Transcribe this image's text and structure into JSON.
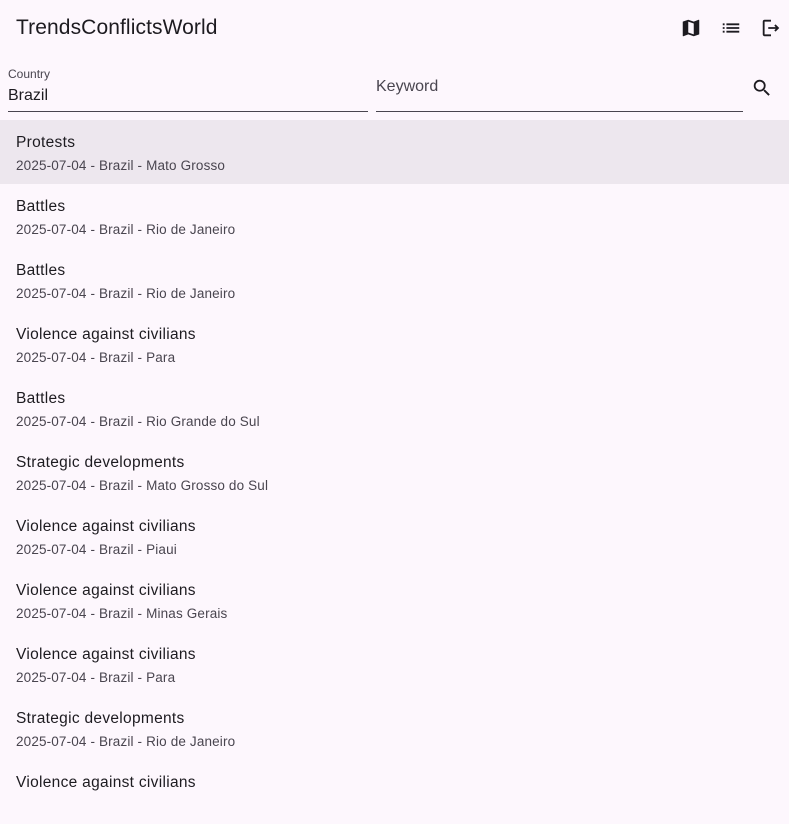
{
  "app": {
    "title": "TrendsConflictsWorld",
    "icons": [
      "map-icon",
      "list-icon",
      "logout-icon"
    ]
  },
  "search": {
    "country_label": "Country",
    "country_value": "Brazil",
    "keyword_placeholder": "Keyword",
    "keyword_value": "",
    "search_icon": "search-icon"
  },
  "events": [
    {
      "title": "Protests",
      "subtitle": "2025-07-04 - Brazil - Mato Grosso",
      "selected": true
    },
    {
      "title": "Battles",
      "subtitle": "2025-07-04 - Brazil - Rio de Janeiro"
    },
    {
      "title": "Battles",
      "subtitle": "2025-07-04 - Brazil - Rio de Janeiro"
    },
    {
      "title": "Violence against civilians",
      "subtitle": "2025-07-04 - Brazil - Para"
    },
    {
      "title": "Battles",
      "subtitle": "2025-07-04 - Brazil - Rio Grande do Sul"
    },
    {
      "title": "Strategic developments",
      "subtitle": "2025-07-04 - Brazil - Mato Grosso do Sul"
    },
    {
      "title": "Violence against civilians",
      "subtitle": "2025-07-04 - Brazil - Piaui"
    },
    {
      "title": "Violence against civilians",
      "subtitle": "2025-07-04 - Brazil - Minas Gerais"
    },
    {
      "title": "Violence against civilians",
      "subtitle": "2025-07-04 - Brazil - Para"
    },
    {
      "title": "Strategic developments",
      "subtitle": "2025-07-04 - Brazil - Rio de Janeiro"
    },
    {
      "title": "Violence against civilians",
      "subtitle": ""
    }
  ],
  "colors": {
    "background": "#fdf7fd",
    "selected_row": "#ede7ee",
    "text_primary": "#1d1b20",
    "text_secondary": "#49454f"
  }
}
